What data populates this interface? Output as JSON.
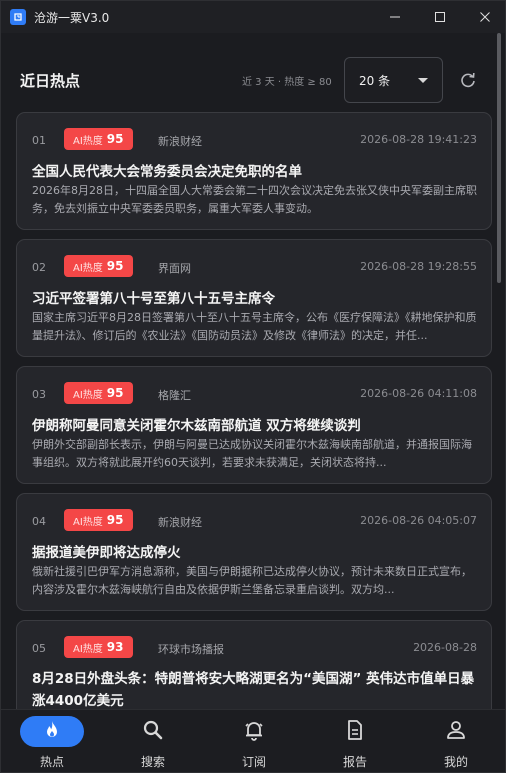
{
  "window": {
    "title": "沧游一粟V3.0"
  },
  "header": {
    "title": "近日热点",
    "filter_hint": "近 3 天 · 热度 ≥ 80",
    "count_select": "20 条"
  },
  "items": [
    {
      "index": "01",
      "badge_label": "AI热度",
      "badge_value": "95",
      "source": "新浪财经",
      "time": "2026-08-28 19:41:23",
      "title": "全国人民代表大会常务委员会决定免职的名单",
      "summary": "2026年8月28日，十四届全国人大常委会第二十四次会议决定免去张又侠中央军委副主席职务，免去刘振立中央军委委员职务，属重大军委人事变动。"
    },
    {
      "index": "02",
      "badge_label": "AI热度",
      "badge_value": "95",
      "source": "界面网",
      "time": "2026-08-28 19:28:55",
      "title": "习近平签署第八十号至第八十五号主席令",
      "summary": "国家主席习近平8月28日签署第八十至八十五号主席令，公布《医疗保障法》《耕地保护和质量提升法》、修订后的《农业法》《国防动员法》及修改《律师法》的决定，并任..."
    },
    {
      "index": "03",
      "badge_label": "AI热度",
      "badge_value": "95",
      "source": "格隆汇",
      "time": "2026-08-26 04:11:08",
      "title": "伊朗称阿曼同意关闭霍尔木兹南部航道 双方将继续谈判",
      "summary": "伊朗外交部副部长表示，伊朗与阿曼已达成协议关闭霍尔木兹海峡南部航道，并通报国际海事组织。双方将就此展开约60天谈判，若要求未获满足，关闭状态将持..."
    },
    {
      "index": "04",
      "badge_label": "AI热度",
      "badge_value": "95",
      "source": "新浪财经",
      "time": "2026-08-26 04:05:07",
      "title": "据报道美伊即将达成停火",
      "summary": "俄新社援引巴伊军方消息源称，美国与伊朗据称已达成停火协议，预计未来数日正式宣布，内容涉及霍尔木兹海峡航行自由及依据伊斯兰堡备忘录重启谈判。双方均..."
    },
    {
      "index": "05",
      "badge_label": "AI热度",
      "badge_value": "93",
      "source": "环球市场播报",
      "time": "2026-08-28",
      "title": "8月28日外盘头条：特朗普将安大略湖更名为“美国湖” 英伟达市值单日暴涨4400亿美元",
      "summary": ""
    }
  ],
  "nav": [
    {
      "label": "热点",
      "icon": "flame-icon",
      "active": true
    },
    {
      "label": "搜索",
      "icon": "search-icon",
      "active": false
    },
    {
      "label": "订阅",
      "icon": "bell-icon",
      "active": false
    },
    {
      "label": "报告",
      "icon": "document-icon",
      "active": false
    },
    {
      "label": "我的",
      "icon": "user-icon",
      "active": false
    }
  ],
  "colors": {
    "accent": "#2f7cf6",
    "badge": "#f44747",
    "background": "#1b1c20",
    "card": "#25262b"
  }
}
